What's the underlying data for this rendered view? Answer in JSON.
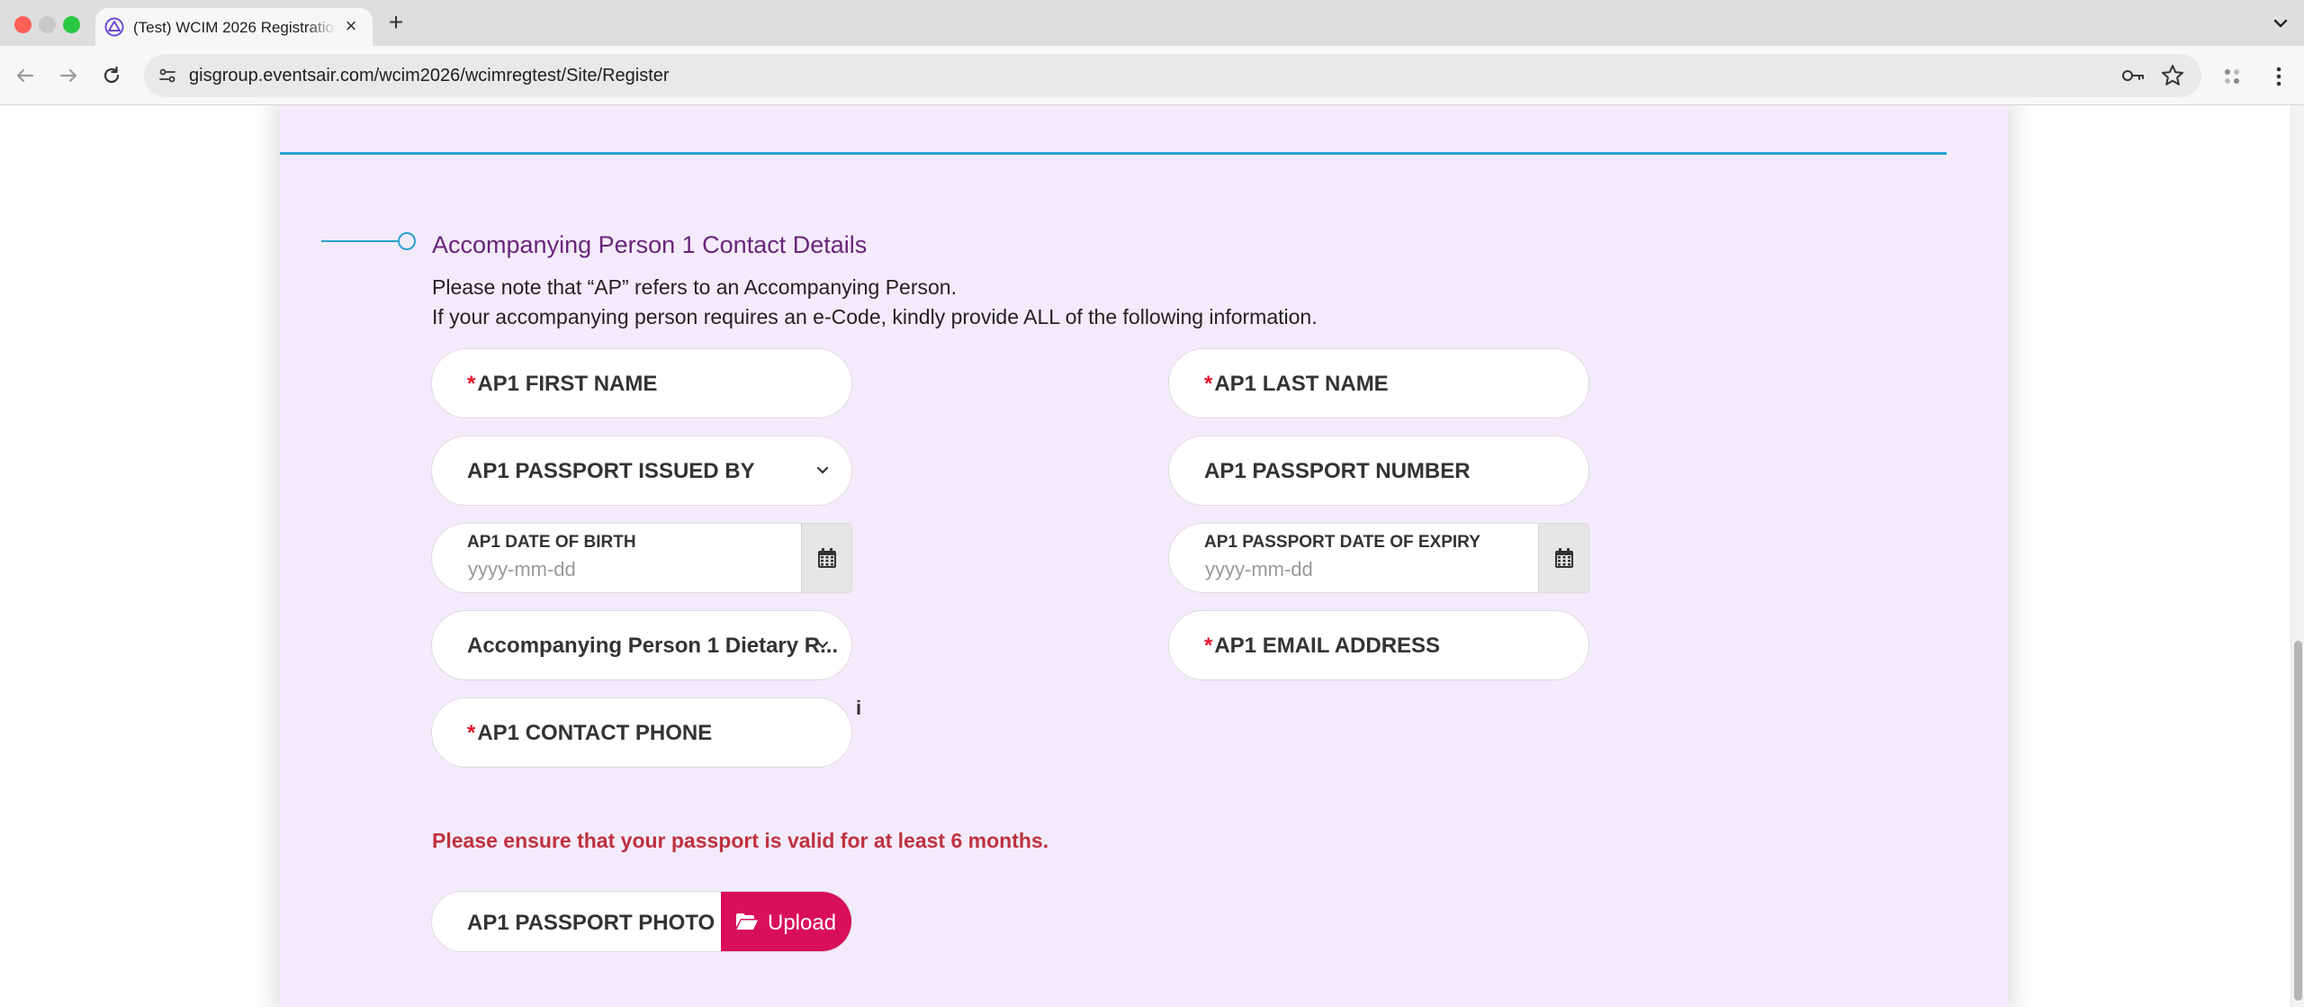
{
  "browser": {
    "tab_title": "(Test) WCIM 2026 Registration",
    "url": "gisgroup.eventsair.com/wcim2026/wcimregtest/Site/Register"
  },
  "section": {
    "title": "Accompanying Person 1 Contact Details",
    "note_line1": "Please note that “AP” refers to an Accompanying Person.",
    "note_line2": "If your accompanying person requires an e-Code, kindly provide ALL of the following information."
  },
  "fields": {
    "first_name": "AP1 FIRST NAME",
    "last_name": "AP1 LAST NAME",
    "passport_issued_by": "AP1 PASSPORT ISSUED BY",
    "passport_number": "AP1 PASSPORT NUMBER",
    "date_of_birth": "AP1 DATE OF BIRTH",
    "date_of_birth_placeholder": "yyyy-mm-dd",
    "passport_expiry": "AP1 PASSPORT DATE OF EXPIRY",
    "passport_expiry_placeholder": "yyyy-mm-dd",
    "dietary": "Accompanying Person 1 Dietary R...",
    "email": "AP1 EMAIL ADDRESS",
    "contact_phone": "AP1 CONTACT PHONE",
    "required_marker": "*",
    "info_marker": "i"
  },
  "warning": "Please ensure that your passport is valid for at least 6 months.",
  "upload": {
    "label": "AP1 PASSPORT PHOTO",
    "button": "Upload"
  },
  "icons": {
    "calendar": "calendar-icon",
    "chevron": "chevron-down-icon",
    "folder": "folder-open-icon",
    "info": "info-icon"
  },
  "colors": {
    "page_background": "#f3ebfb",
    "section_title": "#6a247a",
    "accent_line": "#2aa3cd",
    "required": "#e8152c",
    "warning": "#c0313f",
    "upload_button": "#d90f5a"
  }
}
